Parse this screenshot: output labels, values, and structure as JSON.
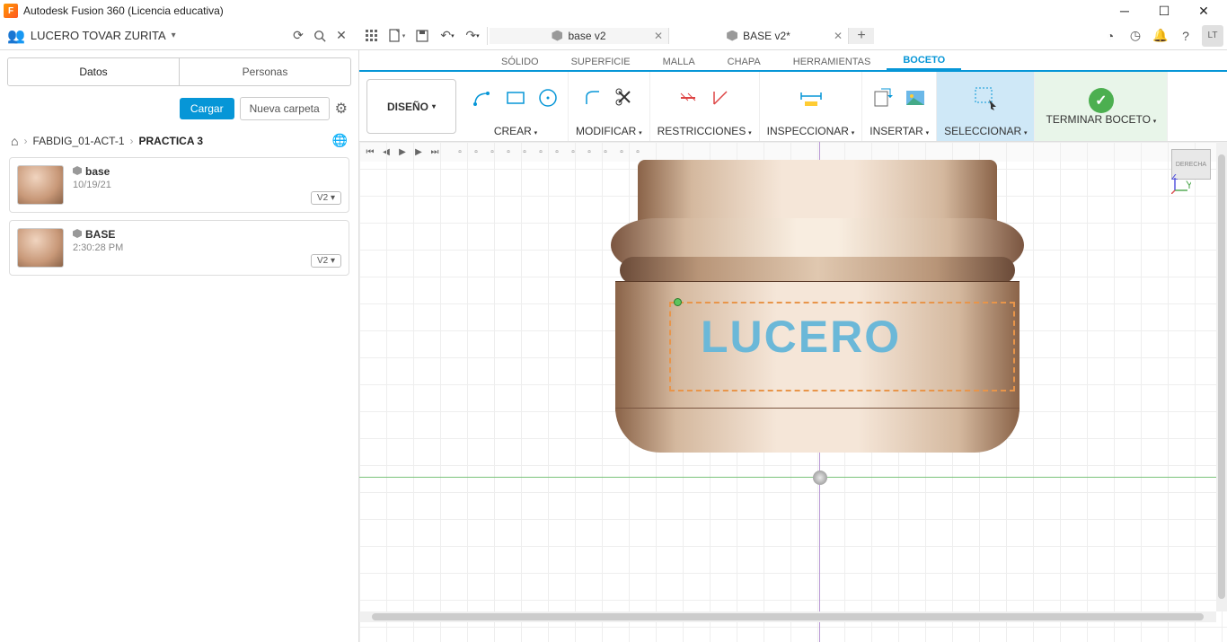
{
  "titlebar": {
    "app": "Autodesk Fusion 360 (Licencia educativa)"
  },
  "user": {
    "name": "LUCERO TOVAR ZURITA",
    "avatar": "LT"
  },
  "doctabs": [
    {
      "label": "base v2",
      "active": false
    },
    {
      "label": "BASE v2*",
      "active": true
    }
  ],
  "sidebar": {
    "tabs": {
      "datos": "Datos",
      "personas": "Personas"
    },
    "buttons": {
      "cargar": "Cargar",
      "nueva": "Nueva carpeta"
    },
    "breadcrumb": {
      "c1": "FABDIG_01-ACT-1",
      "c2": "PRACTICA 3"
    },
    "files": [
      {
        "name": "base",
        "time": "10/19/21",
        "ver": "V2 ▾"
      },
      {
        "name": "BASE",
        "time": "2:30:28 PM",
        "ver": "V2 ▾"
      }
    ]
  },
  "ribbon": {
    "design": "DISEÑO",
    "tabs": {
      "solido": "SÓLIDO",
      "superficie": "SUPERFICIE",
      "malla": "MALLA",
      "chapa": "CHAPA",
      "herramientas": "HERRAMIENTAS",
      "boceto": "BOCETO"
    },
    "groups": {
      "crear": "CREAR",
      "modificar": "MODIFICAR",
      "restricciones": "RESTRICCIONES",
      "inspeccionar": "INSPECCIONAR",
      "insertar": "INSERTAR",
      "seleccionar": "SELECCIONAR",
      "terminar": "TERMINAR BOCETO"
    }
  },
  "viewcube": {
    "face": "DERECHA"
  },
  "canvas": {
    "engraved": "LUCERO"
  }
}
